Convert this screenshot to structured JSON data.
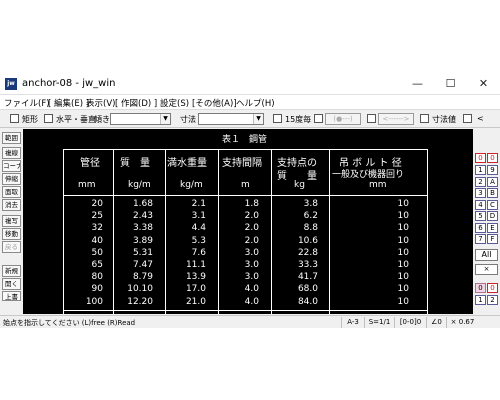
{
  "window": {
    "title": "anchor-08 - jw_win",
    "app_icon_text": "jw",
    "minimize_glyph": "—",
    "maximize_glyph": "☐",
    "close_glyph": "✕"
  },
  "menu": [
    "ファイル(F)",
    "[ 編集(E) ]",
    "表示(V)",
    "[ 作図(D) ]",
    "設定(S)",
    "[その他(A)]",
    "ヘルプ(H)"
  ],
  "toolbar": {
    "rect_label": "矩形",
    "hv_label": "水平・垂直",
    "tilt_label": "傾き",
    "dim_label": "寸法",
    "times15_label": "15度毎",
    "dimval_label": "寸法値",
    "lt_label": "<",
    "btn_a": "(●---)",
    "btn_b": "<------>",
    "combo_arrow": "▼"
  },
  "left_tools": [
    "範囲",
    "複線",
    "コーナー",
    "伸縮",
    "面取",
    "消去",
    "複写",
    "移動",
    "戻る",
    "新規",
    "開く",
    "上書"
  ],
  "right_tools": {
    "layer_grp": "0",
    "layer_0": "0",
    "rows": [
      [
        "1",
        "9"
      ],
      [
        "2",
        "A"
      ],
      [
        "3",
        "B"
      ],
      [
        "4",
        "C"
      ],
      [
        "5",
        "D"
      ],
      [
        "6",
        "E"
      ],
      [
        "7",
        "F"
      ]
    ],
    "all": "All",
    "x": "×",
    "layer_grp2": "0",
    "layer_02": "0",
    "row_last": [
      "1",
      "2"
    ]
  },
  "table": {
    "title": "表１　鋼管",
    "headers": {
      "pipe": "管径",
      "weight": "質　量",
      "water": "満水重量",
      "interval": "支持間隔",
      "support_top": "支持点の",
      "support_bottom": "質　　量",
      "bolt_top": "吊 ボ ル ト 径",
      "bolt_bottom": "一般及び機器回り"
    },
    "units": {
      "pipe": "mm",
      "weight": "kg/m",
      "water": "kg/m",
      "interval": "m",
      "support": "kg",
      "bolt": "mm"
    },
    "rows": [
      {
        "pipe": "20",
        "weight": "1.68",
        "water": "2.1",
        "interval": "1.8",
        "support": "3.8",
        "bolt": "10"
      },
      {
        "pipe": "25",
        "weight": "2.43",
        "water": "3.1",
        "interval": "2.0",
        "support": "6.2",
        "bolt": "10"
      },
      {
        "pipe": "32",
        "weight": "3.38",
        "water": "4.4",
        "interval": "2.0",
        "support": "8.8",
        "bolt": "10"
      },
      {
        "pipe": "40",
        "weight": "3.89",
        "water": "5.3",
        "interval": "2.0",
        "support": "10.6",
        "bolt": "10"
      },
      {
        "pipe": "50",
        "weight": "5.31",
        "water": "7.6",
        "interval": "3.0",
        "support": "22.8",
        "bolt": "10"
      },
      {
        "pipe": "65",
        "weight": "7.47",
        "water": "11.1",
        "interval": "3.0",
        "support": "33.3",
        "bolt": "10"
      },
      {
        "pipe": "80",
        "weight": "8.79",
        "water": "13.9",
        "interval": "3.0",
        "support": "41.7",
        "bolt": "10"
      },
      {
        "pipe": "90",
        "weight": "10.10",
        "water": "17.0",
        "interval": "4.0",
        "support": "68.0",
        "bolt": "10"
      },
      {
        "pipe": "100",
        "weight": "12.20",
        "water": "21.0",
        "interval": "4.0",
        "support": "84.0",
        "bolt": "10"
      }
    ]
  },
  "status": {
    "message": "始点を指示してください (L)free (R)Read",
    "paper": "A-3",
    "scale": "S=1/1",
    "layer": "[0-0]0",
    "angle": "∠0",
    "zoom": "× 0.67"
  },
  "colors": {
    "canvas_bg": "#000000",
    "canvas_fg": "#ffffff",
    "accent_red": "#d0202a",
    "accent_pink": "#f2d6e6"
  }
}
